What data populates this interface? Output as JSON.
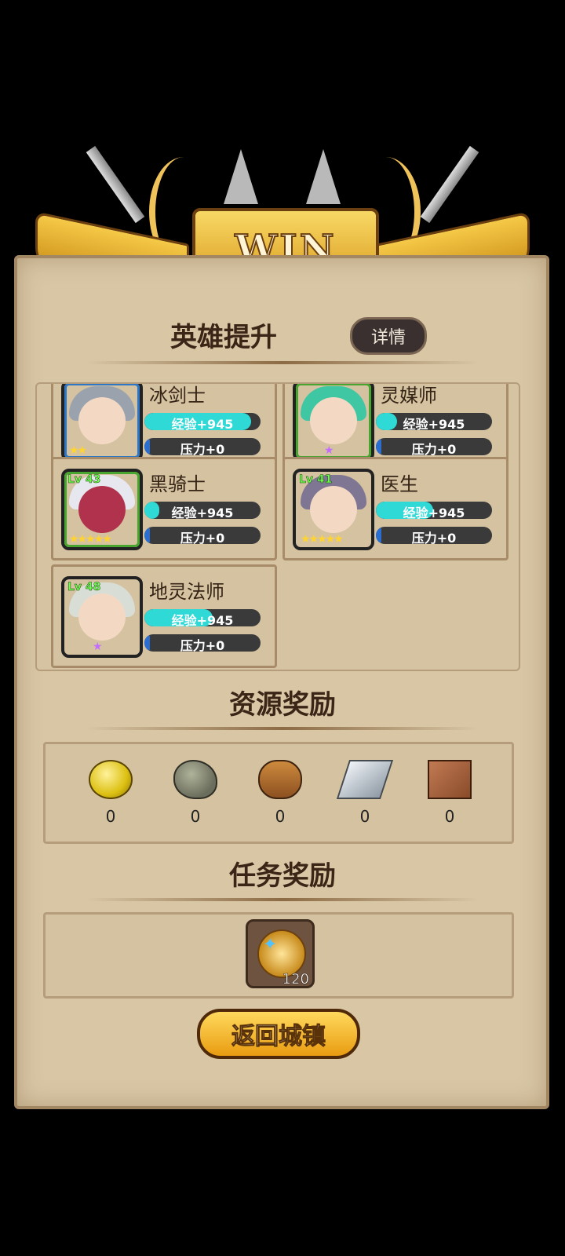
{
  "banner": {
    "title": "WIN"
  },
  "sections": {
    "hero_upgrade": "英雄提升",
    "details_button": "详情",
    "resource_rewards": "资源奖励",
    "task_rewards": "任务奖励"
  },
  "heroes": [
    {
      "name": "冰剑士",
      "level": "",
      "exp": "经验+945",
      "pressure": "压力+0",
      "stars": "★★",
      "exp_fill_pct": 92,
      "pressure_fill_pct": 5
    },
    {
      "name": "灵媒师",
      "level": "",
      "exp": "经验+945",
      "pressure": "压力+0",
      "stars": "★",
      "exp_fill_pct": 18,
      "pressure_fill_pct": 5
    },
    {
      "name": "黑骑士",
      "level": "Lv 43",
      "exp": "经验+945",
      "pressure": "压力+0",
      "stars": "★★★★★",
      "exp_fill_pct": 13,
      "pressure_fill_pct": 5
    },
    {
      "name": "医生",
      "level": "Lv 41",
      "exp": "经验+945",
      "pressure": "压力+0",
      "stars": "★★★★★",
      "exp_fill_pct": 49,
      "pressure_fill_pct": 5
    },
    {
      "name": "地灵法师",
      "level": "Lv 48",
      "exp": "经验+945",
      "pressure": "压力+0",
      "stars": "★",
      "exp_fill_pct": 59,
      "pressure_fill_pct": 5
    }
  ],
  "resources": [
    {
      "icon": "gold-coin-icon",
      "count": "0"
    },
    {
      "icon": "stone-icon",
      "count": "0"
    },
    {
      "icon": "wood-log-icon",
      "count": "0"
    },
    {
      "icon": "iron-ingot-icon",
      "count": "0"
    },
    {
      "icon": "cloth-icon",
      "count": "0"
    }
  ],
  "task_reward": {
    "icon": "medal-gem-icon",
    "count": "120"
  },
  "return_button": "返回城镇",
  "colors": {
    "panel": "#d8c6a5",
    "exp_bar": "#2fd9d6",
    "pressure_bar": "#2b6ed2",
    "gold": "#e9a91a"
  }
}
